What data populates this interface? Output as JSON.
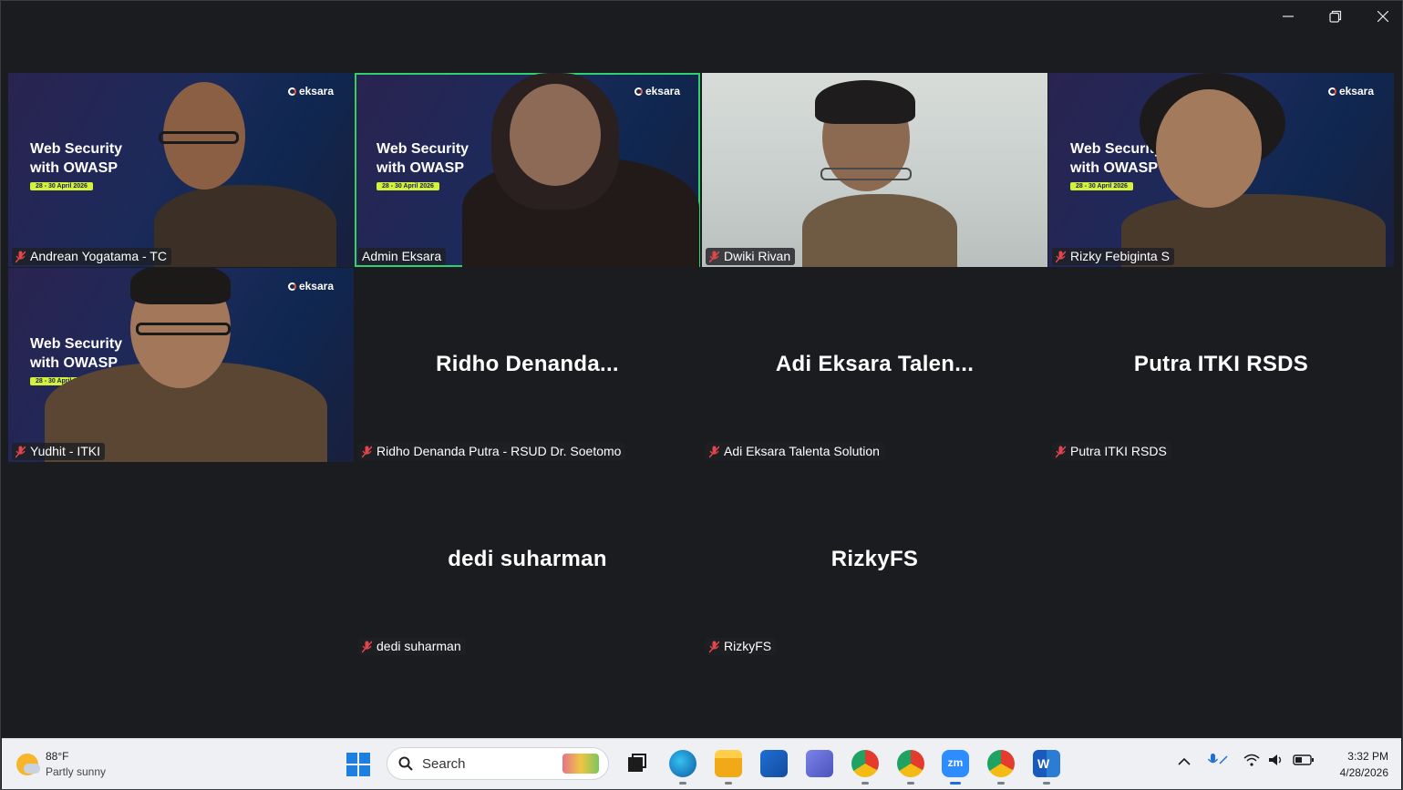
{
  "window": {
    "controls": [
      "minimize",
      "restore",
      "close"
    ]
  },
  "banner": {
    "title_line1": "Web Security",
    "title_line2": "with OWASP",
    "dates": "28 - 30 April 2026",
    "logo": "eksara"
  },
  "participants": [
    {
      "label": "Andrean Yogatama - TC",
      "muted": true,
      "video": true
    },
    {
      "label": "Admin Eksara",
      "muted": false,
      "video": true,
      "active_speaker": true
    },
    {
      "label": "Dwiki Rivan",
      "muted": true,
      "video": true
    },
    {
      "label": "Rizky Febiginta S",
      "muted": true,
      "video": true
    },
    {
      "label": "Yudhit - ITKI",
      "muted": true,
      "video": true
    },
    {
      "label": "Ridho Denanda Putra - RSUD Dr. Soetomo",
      "display": "Ridho  Denanda...",
      "muted": true,
      "video": false
    },
    {
      "label": "Adi Eksara Talenta Solution",
      "display": "Adi  Eksara  Talen...",
      "muted": true,
      "video": false
    },
    {
      "label": "Putra ITKI RSDS",
      "display": "Putra ITKI RSDS",
      "muted": true,
      "video": false
    },
    {
      "label": "dedi suharman",
      "display": "dedi suharman",
      "muted": true,
      "video": false
    },
    {
      "label": "RizkyFS",
      "display": "RizkyFS",
      "muted": true,
      "video": false
    }
  ],
  "taskbar": {
    "weather_temp": "88°F",
    "weather_desc": "Partly sunny",
    "search_placeholder": "Search",
    "apps": [
      "start-icon",
      "task-view-icon",
      "edge-icon",
      "file-explorer-icon",
      "store-icon",
      "teams-icon",
      "chrome-icon",
      "chrome-profile-icon",
      "zoom-icon",
      "chrome-k-icon",
      "word-icon"
    ],
    "time": "3:32 PM",
    "date": "4/28/2026"
  },
  "colors": {
    "active_speaker_border": "#2fd06d",
    "muted_icon": "#e0464b",
    "meeting_bg": "#1a1c1f"
  }
}
